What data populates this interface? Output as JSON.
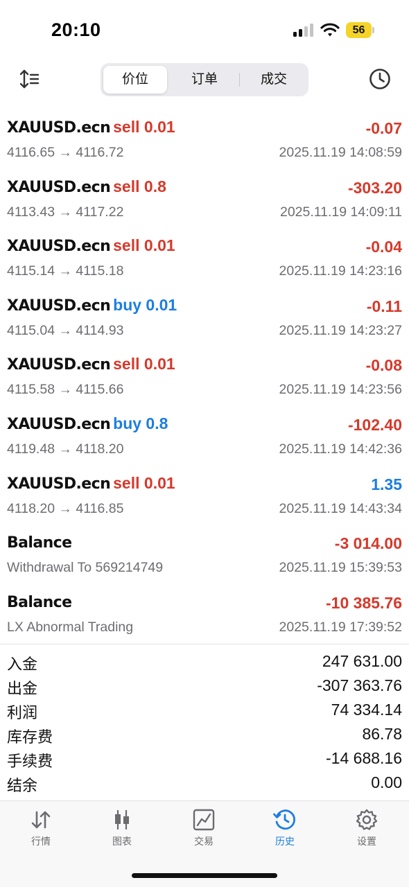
{
  "status_bar": {
    "time": "20:10",
    "battery": "56"
  },
  "toolbar": {
    "segments": [
      "价位",
      "订单",
      "成交"
    ],
    "active_segment": "价位"
  },
  "deals": [
    {
      "symbol": "XAUUSD.ecn",
      "side": "sell",
      "volume": "0.01",
      "profit": "-0.07",
      "prices": "4116.65 → 4116.72",
      "datetime": "2025.11.19 14:08:59"
    },
    {
      "symbol": "XAUUSD.ecn",
      "side": "sell",
      "volume": "0.8",
      "profit": "-303.20",
      "prices": "4113.43 → 4117.22",
      "datetime": "2025.11.19 14:09:11"
    },
    {
      "symbol": "XAUUSD.ecn",
      "side": "sell",
      "volume": "0.01",
      "profit": "-0.04",
      "prices": "4115.14 → 4115.18",
      "datetime": "2025.11.19 14:23:16"
    },
    {
      "symbol": "XAUUSD.ecn",
      "side": "buy",
      "volume": "0.01",
      "profit": "-0.11",
      "prices": "4115.04 → 4114.93",
      "datetime": "2025.11.19 14:23:27"
    },
    {
      "symbol": "XAUUSD.ecn",
      "side": "sell",
      "volume": "0.01",
      "profit": "-0.08",
      "prices": "4115.58 → 4115.66",
      "datetime": "2025.11.19 14:23:56"
    },
    {
      "symbol": "XAUUSD.ecn",
      "side": "buy",
      "volume": "0.8",
      "profit": "-102.40",
      "prices": "4119.48 → 4118.20",
      "datetime": "2025.11.19 14:42:36"
    },
    {
      "symbol": "XAUUSD.ecn",
      "side": "sell",
      "volume": "0.01",
      "profit": "1.35",
      "prices": "4118.20 → 4116.85",
      "datetime": "2025.11.19 14:43:34"
    },
    {
      "symbol": "Balance",
      "side": "",
      "volume": "",
      "profit": "-3 014.00",
      "prices": "Withdrawal To 569214749",
      "datetime": "2025.11.19 15:39:53"
    },
    {
      "symbol": "Balance",
      "side": "",
      "volume": "",
      "profit": "-10 385.76",
      "prices": "LX Abnormal Trading",
      "datetime": "2025.11.19 17:39:52"
    }
  ],
  "summary": [
    {
      "label": "入金",
      "value": "247 631.00"
    },
    {
      "label": "出金",
      "value": "-307 363.76"
    },
    {
      "label": "利润",
      "value": "74 334.14"
    },
    {
      "label": "库存费",
      "value": "86.78"
    },
    {
      "label": "手续费",
      "value": "-14 688.16"
    },
    {
      "label": "结余",
      "value": "0.00"
    }
  ],
  "tabbar": {
    "tabs": [
      {
        "label": "行情",
        "icon": "quotes-arrows-icon"
      },
      {
        "label": "图表",
        "icon": "candlestick-chart-icon"
      },
      {
        "label": "交易",
        "icon": "trade-chart-icon"
      },
      {
        "label": "历史",
        "icon": "history-clock-icon"
      },
      {
        "label": "设置",
        "icon": "gear-icon"
      }
    ],
    "active": "历史"
  },
  "colors": {
    "sell": "#d6392b",
    "buy": "#1c7ee0",
    "negative": "#d6392b",
    "positive": "#1c7ee0",
    "accent": "#1c7ee0",
    "battery": "#f5d42a"
  }
}
